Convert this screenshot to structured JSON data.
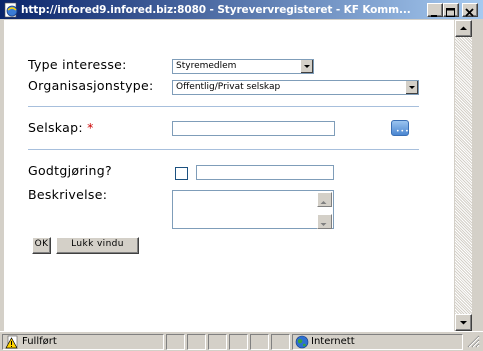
{
  "window": {
    "title": "http://infored9.infored.biz:8080 - Styrevervregisteret - KF Komm...",
    "colors": {
      "titlebar_start": "#0a246a",
      "titlebar_end": "#a6caf0",
      "required": "#cc0000",
      "divider": "#a7bfdc"
    }
  },
  "form": {
    "type_interesse": {
      "label": "Type interesse:",
      "selected": "Styremedlem"
    },
    "organisasjonstype": {
      "label": "Organisasjonstype:",
      "selected": "Offentlig/Privat selskap"
    },
    "selskap": {
      "label": "Selskap:",
      "required_mark": "*",
      "value": "",
      "lookup_icon": "ellipsis-lookup-icon"
    },
    "godtgjoring": {
      "label": "Godtgjøring?",
      "checked": false,
      "value": ""
    },
    "beskrivelse": {
      "label": "Beskrivelse:",
      "value": ""
    },
    "buttons": {
      "ok": "OK",
      "lukk": "Lukk vindu"
    }
  },
  "statusbar": {
    "status": "Fullført",
    "zone": "Internett",
    "icons": [
      "warning-page-icon",
      "globe-icon"
    ]
  }
}
